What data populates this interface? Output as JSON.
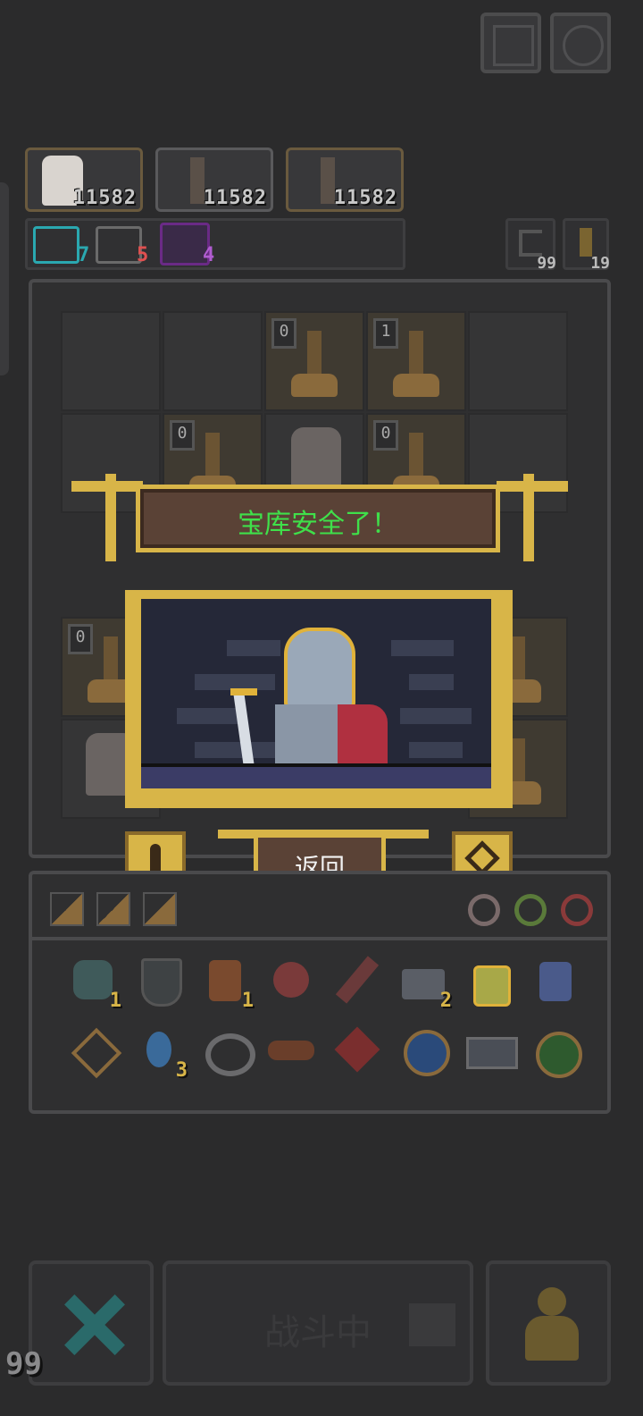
{
  "top_buttons": [
    {
      "name": "help-button",
      "icon": "question-icon"
    },
    {
      "name": "settings-button",
      "icon": "gear-icon"
    }
  ],
  "heroes": [
    {
      "value": "11582",
      "portrait": "white-hair-girl-avatar"
    },
    {
      "value": "11582",
      "portrait": "tree-stump-avatar"
    },
    {
      "value": "11582",
      "portrait": "tree-stump-avatar"
    }
  ],
  "counters": [
    {
      "icon": "teal-ring-icon",
      "value": "7",
      "color": "#2aa8b0"
    },
    {
      "icon": "skull-icon",
      "value": "5",
      "color": "#e05050"
    },
    {
      "icon": "purple-crystal-icon",
      "value": "4",
      "color": "#b05cd0"
    }
  ],
  "right_counters": [
    {
      "icon": "return-arrow-icon",
      "value": "99"
    },
    {
      "icon": "key-icon",
      "value": "19"
    }
  ],
  "board_badges": [
    "0",
    "1",
    "0",
    "0",
    "0"
  ],
  "modal": {
    "title": "宝库安全了！",
    "back_label": "返回",
    "left_icon": "keyhole-icon",
    "right_icon": "heart-gem-icon",
    "scene": "armored-knight-with-sword"
  },
  "inventory": {
    "row1": [
      {
        "icon": "heart-shield-icon",
        "count": "1"
      },
      {
        "icon": "shield-icon",
        "count": ""
      },
      {
        "icon": "barrel-icon",
        "count": "1"
      },
      {
        "icon": "flower-icon",
        "count": ""
      },
      {
        "icon": "ribbon-icon",
        "count": ""
      },
      {
        "icon": "lock-chest-icon",
        "count": "2"
      },
      {
        "icon": "potion-icon",
        "count": ""
      },
      {
        "icon": "jar-icon",
        "count": ""
      }
    ],
    "row2": [
      {
        "icon": "diamond-sigil-icon",
        "count": ""
      },
      {
        "icon": "water-drop-icon",
        "count": "3"
      },
      {
        "icon": "rope-icon",
        "count": ""
      },
      {
        "icon": "wood-log-icon",
        "count": ""
      },
      {
        "icon": "maple-leaf-icon",
        "count": ""
      },
      {
        "icon": "blue-orb-icon",
        "count": ""
      },
      {
        "icon": "camera-icon",
        "count": ""
      },
      {
        "icon": "green-bomb-icon",
        "count": ""
      }
    ]
  },
  "bottom": {
    "battle_label": "战斗中",
    "level": "99"
  }
}
